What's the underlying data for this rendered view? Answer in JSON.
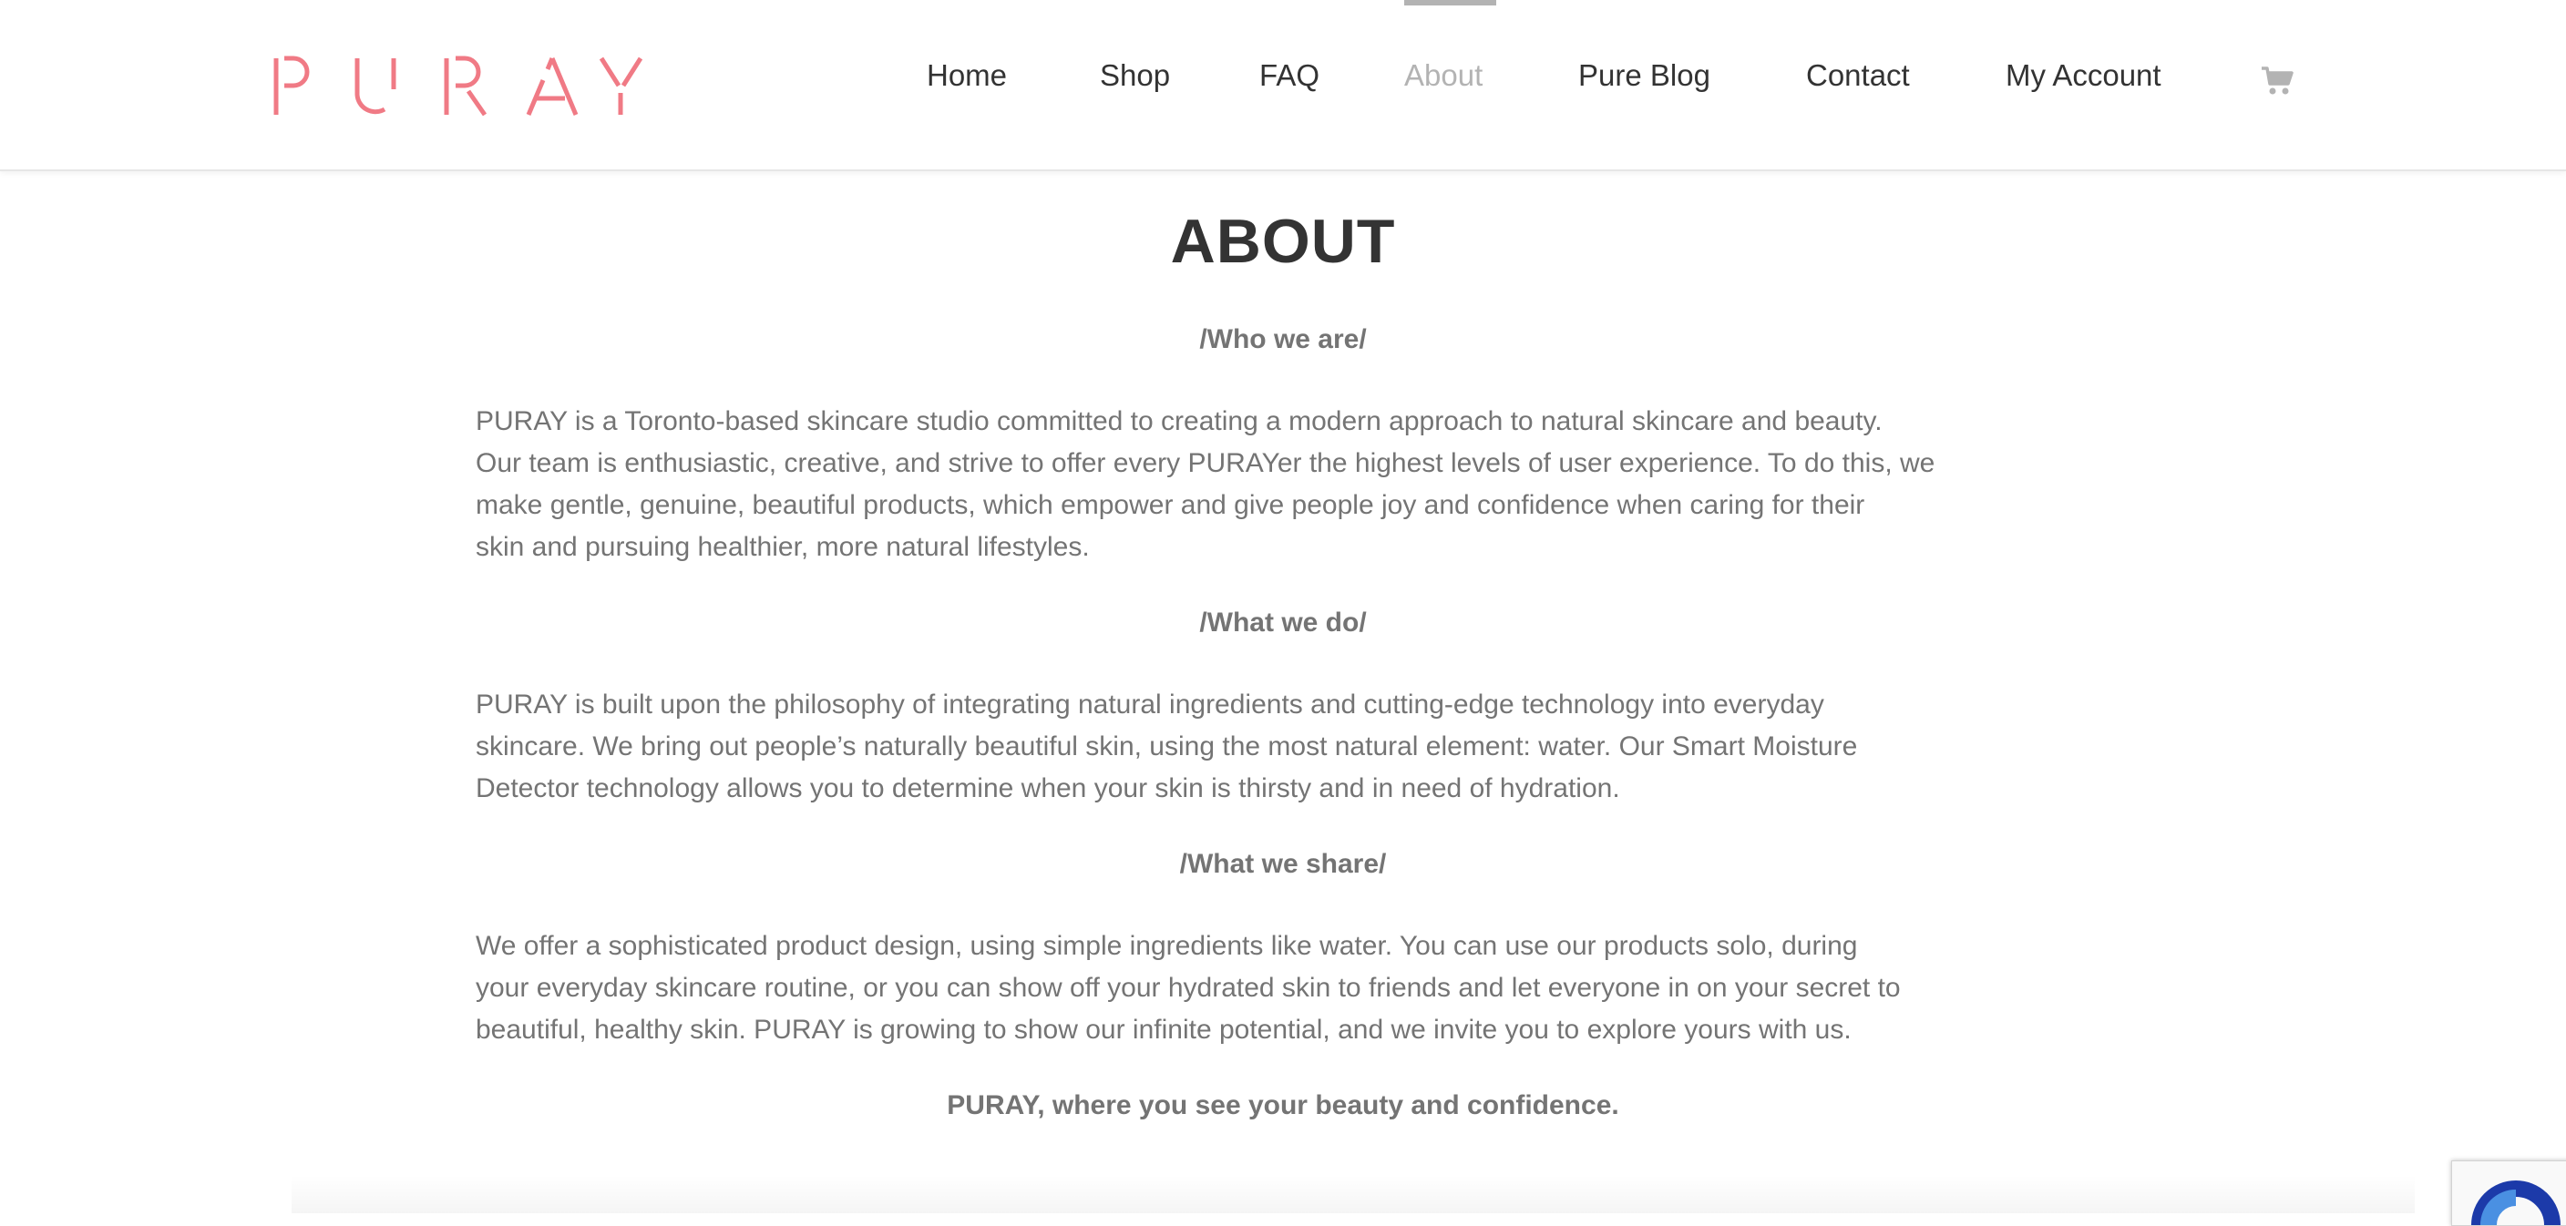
{
  "brand": {
    "name": "PURAY",
    "color": "#f07a85"
  },
  "nav": {
    "items": [
      {
        "label": "Home"
      },
      {
        "label": "Shop"
      },
      {
        "label": "FAQ"
      },
      {
        "label": "About"
      },
      {
        "label": "Pure Blog"
      },
      {
        "label": "Contact"
      },
      {
        "label": "My Account"
      }
    ],
    "active": "About",
    "cart_icon": "shopping-cart-icon"
  },
  "page": {
    "title": "ABOUT",
    "sections": [
      {
        "heading": "/Who we are/",
        "lines": [
          "PURAY is a Toronto-based skincare studio committed to creating a modern approach to natural skincare and beauty.",
          "Our team is enthusiastic, creative, and strive to offer every PURAYer the highest levels of user experience. To do this, we",
          "make gentle, genuine, beautiful products, which empower and give people joy and confidence when caring for their",
          "skin and pursuing healthier, more natural lifestyles."
        ]
      },
      {
        "heading": "/What we do/",
        "lines": [
          "PURAY is built upon the philosophy of integrating natural ingredients and cutting-edge technology into everyday",
          "skincare. We bring out people’s naturally beautiful skin, using the most natural element: water. Our Smart Moisture",
          "Detector technology allows you to determine when your skin is thirsty and in need of hydration."
        ]
      },
      {
        "heading": "/What we share/",
        "lines": [
          "We offer a sophisticated product design, using simple ingredients like water. You can use our products solo, during",
          "your everyday skincare routine, or you can show off your hydrated skin to friends and let everyone in on your secret to",
          "beautiful, healthy skin. PURAY is growing to show our infinite potential, and we invite you to explore yours with us."
        ]
      }
    ],
    "tagline": "PURAY, where you see your beauty and confidence."
  },
  "widgets": {
    "recaptcha_icon": "recaptcha-icon"
  }
}
